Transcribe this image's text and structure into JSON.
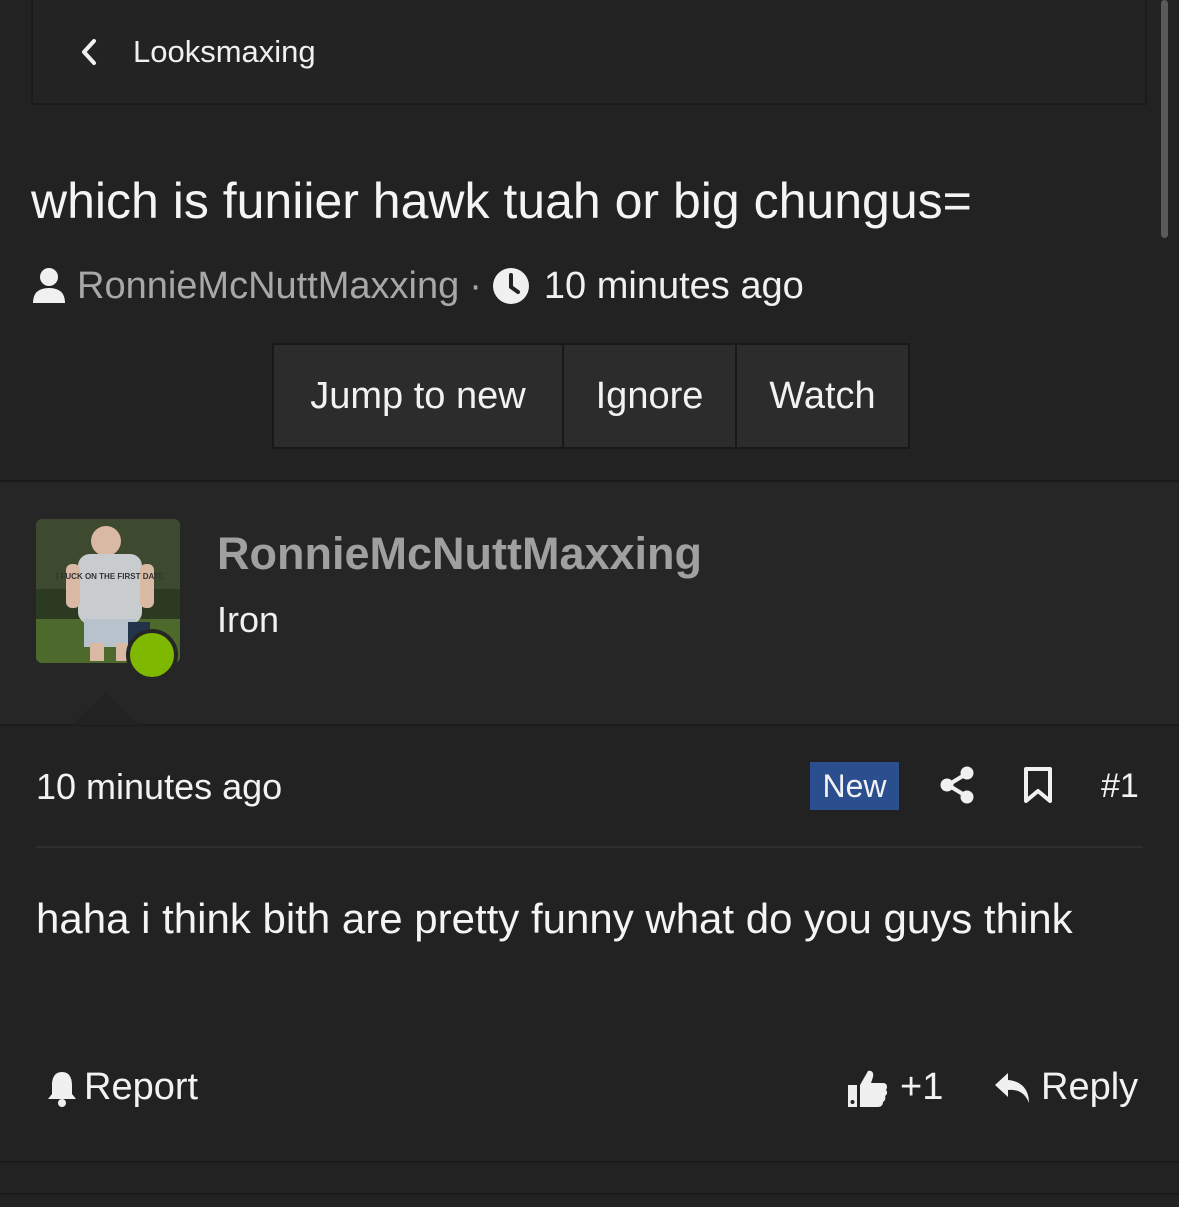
{
  "breadcrumb": {
    "label": "Looksmaxing"
  },
  "thread": {
    "title": "which is funiier hawk tuah or big chungus=",
    "author": "RonnieMcNuttMaxxing",
    "separator": "·",
    "time": "10 minutes ago"
  },
  "actions": {
    "jump": "Jump to new",
    "ignore": "Ignore",
    "watch": "Watch"
  },
  "post": {
    "username": "RonnieMcNuttMaxxing",
    "rank": "Iron",
    "online": true,
    "time": "10 minutes ago",
    "badge": "New",
    "number": "#1",
    "body": "haha i think bith are pretty funny what do you guys think",
    "report_label": "Report",
    "like_count": "+1",
    "reply_label": "Reply",
    "avatar_shirt_text": "I FUCK ON THE FIRST DATE"
  },
  "colors": {
    "background": "#222222",
    "online": "#7fb800",
    "badge": "#2b4e8f",
    "username": "#a0a0a0"
  },
  "icons": [
    "chevron-left-icon",
    "user-icon",
    "clock-icon",
    "share-icon",
    "bookmark-icon",
    "bell-icon",
    "thumbs-up-icon",
    "reply-arrow-icon"
  ]
}
